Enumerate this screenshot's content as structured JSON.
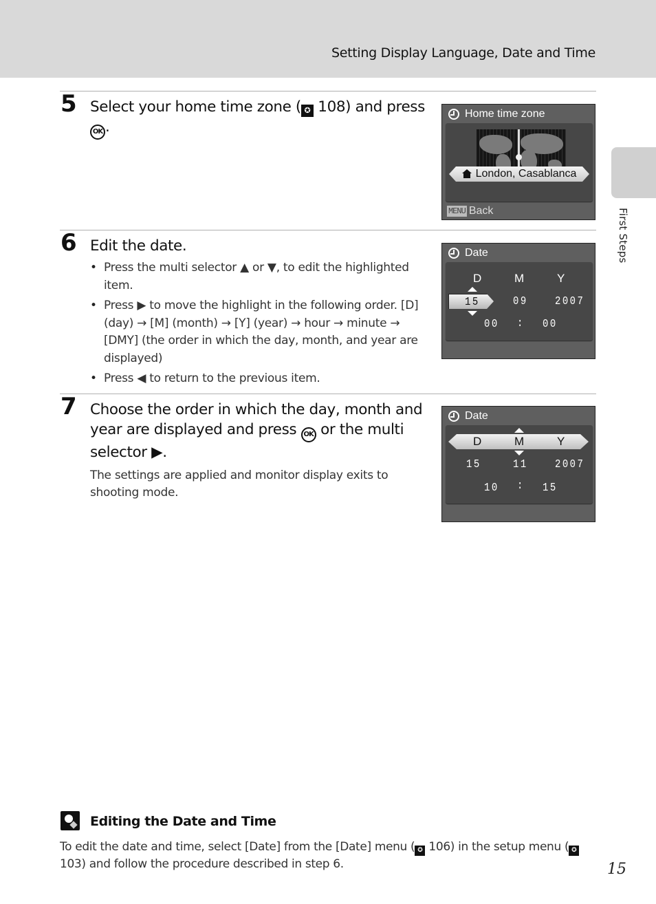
{
  "header": {
    "section_title": "Setting Display Language, Date and Time"
  },
  "side_tab": {
    "label": "First Steps"
  },
  "steps": [
    {
      "number": "5",
      "title_prefix": "Select your home time zone (",
      "ref_page": "108",
      "title_mid": ") and press",
      "title_suffix": ".",
      "screen": {
        "title": "Home time zone",
        "selected_zone": "London, Casablanca",
        "menu_badge": "MENU",
        "back_label": "Back"
      }
    },
    {
      "number": "6",
      "title": "Edit the date.",
      "bullets": [
        {
          "pre": "Press the multi selector",
          "glyph1": "▲",
          "mid": "or",
          "glyph2": "▼",
          "post": ", to edit the highlighted item."
        },
        {
          "pre": "Press",
          "glyph1": "▶",
          "post": "to move the highlight in the following order. [D] (day) → [M] (month) → [Y] (year) → hour → minute → [DMY] (the order in which the day, month, and year are displayed)"
        },
        {
          "pre": "Press",
          "glyph1": "◀",
          "post": "to return to the previous item."
        }
      ],
      "screen": {
        "title": "Date",
        "col_labels": [
          "D",
          "M",
          "Y"
        ],
        "day": "15",
        "month": "09",
        "year": "2007",
        "hour": "00",
        "separator": ":",
        "minute": "00",
        "highlighted": "day"
      }
    },
    {
      "number": "7",
      "title_prefix": "Choose the order in which the day, month and year are displayed and press",
      "title_mid": "or the multi selector",
      "title_glyph": "▶",
      "title_suffix": ".",
      "body": "The settings are applied and monitor display exits to shooting mode.",
      "screen": {
        "title": "Date",
        "col_labels": [
          "D",
          "M",
          "Y"
        ],
        "day": "15",
        "month": "11",
        "year": "2007",
        "hour": "10",
        "separator": ":",
        "minute": "15",
        "highlighted": "DMY order"
      }
    }
  ],
  "icons": {
    "ok": "OK",
    "ref": "✪"
  },
  "tip": {
    "title": "Editing the Date and Time",
    "text_1": "To edit the date and time, select [Date] from the [Date] menu (",
    "ref_1": "106",
    "text_2": ") in the setup menu (",
    "ref_2": "103",
    "text_3": ") and follow the procedure described in step 6."
  },
  "page_number": "15"
}
